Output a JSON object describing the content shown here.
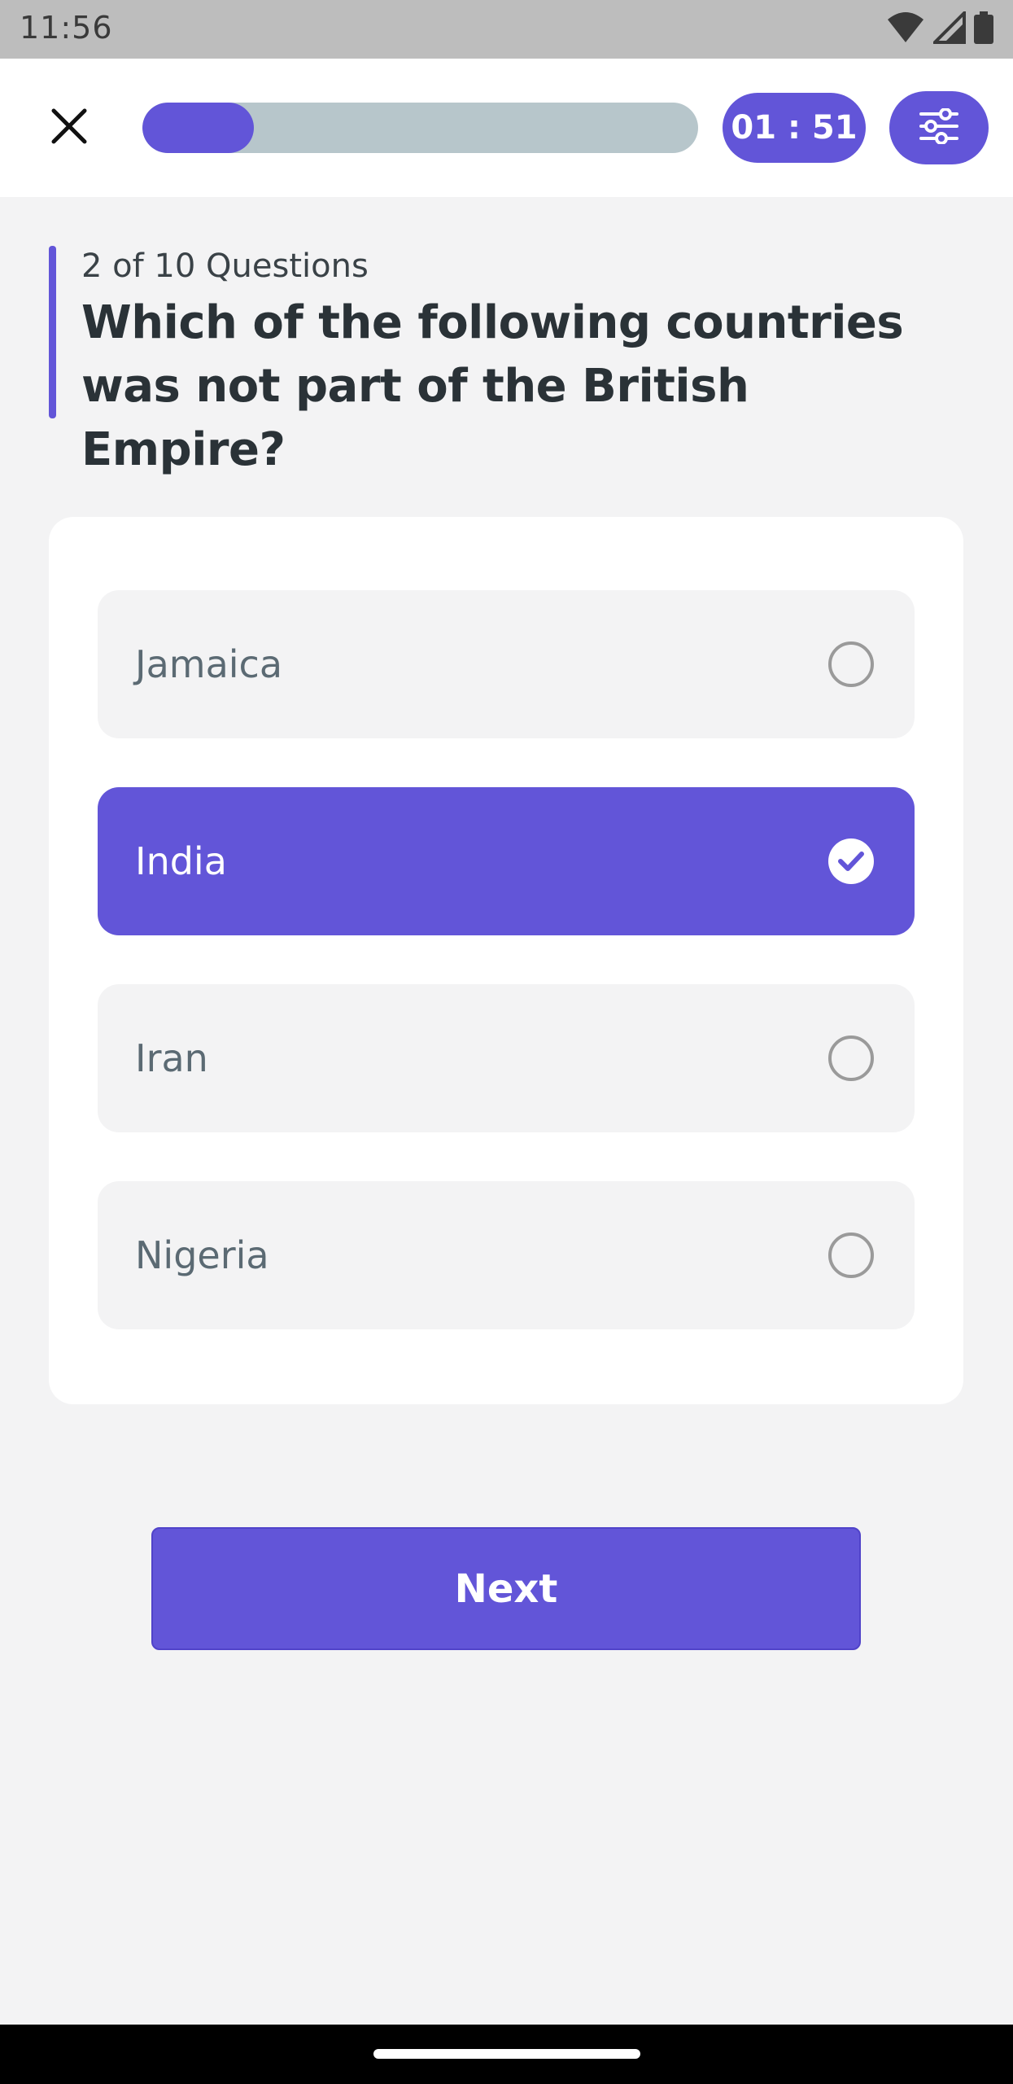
{
  "status_bar": {
    "time": "11:56",
    "icons": [
      "wifi-icon",
      "cell-signal-icon",
      "battery-icon"
    ]
  },
  "header": {
    "close_icon": "close-icon",
    "progress": {
      "current": 2,
      "total": 10,
      "fraction": 0.2
    },
    "timer": "01 : 51",
    "settings_icon": "sliders-icon"
  },
  "question": {
    "counter": "2 of 10 Questions",
    "text": "Which of the following countries was not part of the British Empire?"
  },
  "options": [
    {
      "label": "Jamaica",
      "selected": false
    },
    {
      "label": "India",
      "selected": true
    },
    {
      "label": "Iran",
      "selected": false
    },
    {
      "label": "Nigeria",
      "selected": false
    }
  ],
  "next_button": {
    "label": "Next"
  },
  "colors": {
    "accent": "#6255d8",
    "track": "#b7c6cb",
    "background": "#f3f3f4",
    "card": "#ffffff"
  }
}
